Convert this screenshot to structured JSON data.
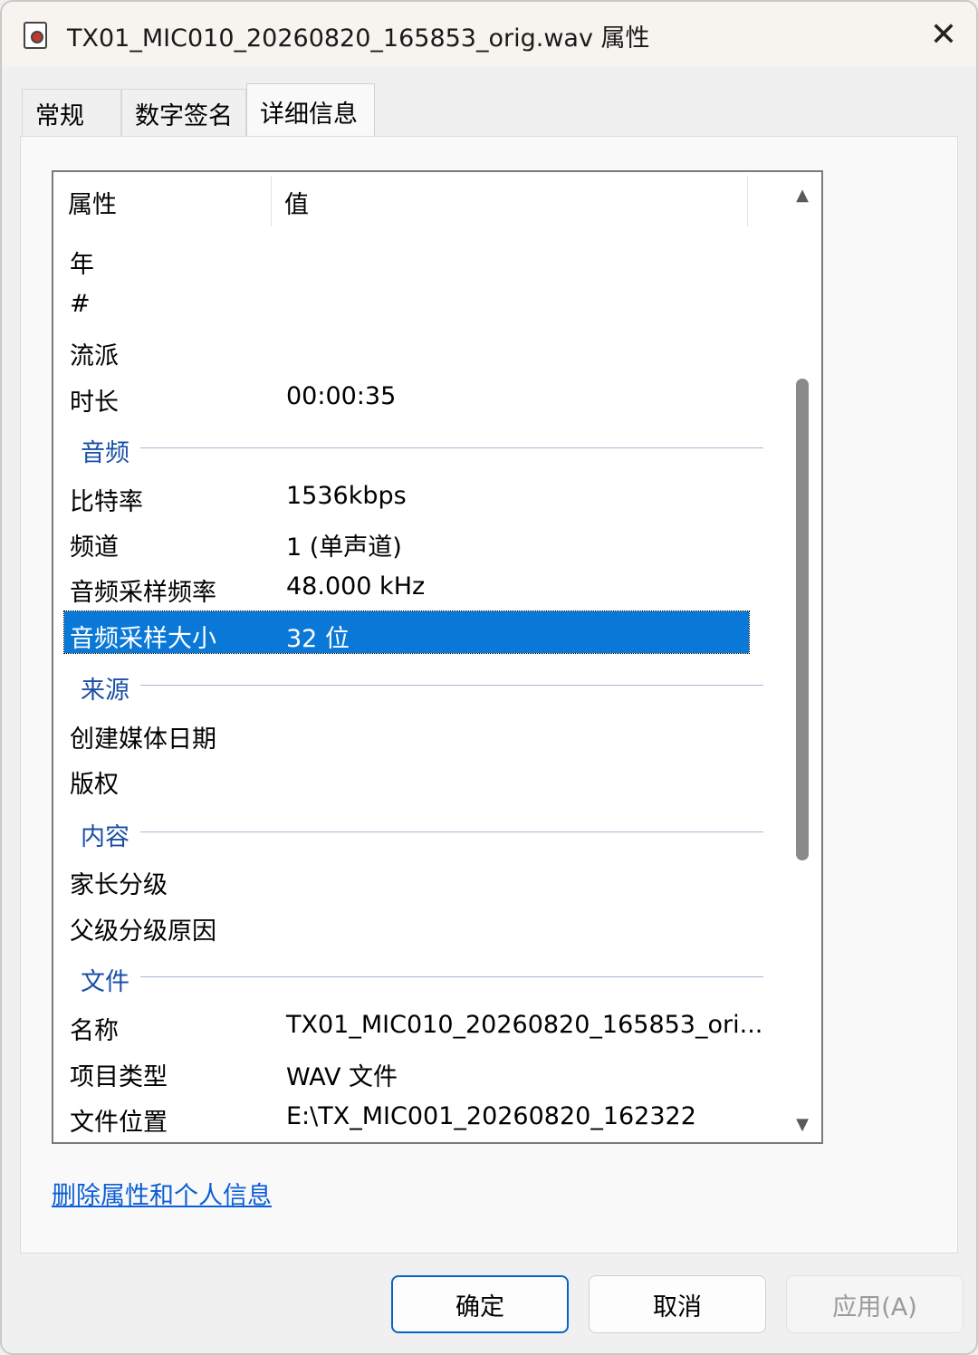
{
  "window": {
    "title": "TX01_MIC010_20260820_165853_orig.wav 属性",
    "close_glyph": "✕"
  },
  "tabs": [
    {
      "label": "常规"
    },
    {
      "label": "数字签名"
    },
    {
      "label": "详细信息"
    }
  ],
  "list": {
    "col_property": "属性",
    "col_value": "值",
    "scroll_up": "▲",
    "scroll_down": "▼",
    "rows_top": [
      {
        "key": "年",
        "value": ""
      },
      {
        "key": "#",
        "value": ""
      },
      {
        "key": "流派",
        "value": ""
      },
      {
        "key": "时长",
        "value": "00:00:35"
      }
    ],
    "groups": {
      "audio": "音频",
      "source": "来源",
      "content": "内容",
      "file": "文件"
    },
    "audio_rows": [
      {
        "key": "比特率",
        "value": "1536kbps"
      },
      {
        "key": "频道",
        "value": "1 (单声道)"
      },
      {
        "key": "音频采样频率",
        "value": "48.000 kHz"
      },
      {
        "key": "音频采样大小",
        "value": "32 位"
      }
    ],
    "source_rows": [
      {
        "key": "创建媒体日期",
        "value": ""
      },
      {
        "key": "版权",
        "value": ""
      }
    ],
    "content_rows": [
      {
        "key": "家长分级",
        "value": ""
      },
      {
        "key": "父级分级原因",
        "value": ""
      }
    ],
    "file_rows": [
      {
        "key": "名称",
        "value": "TX01_MIC010_20260820_165853_ori..."
      },
      {
        "key": "项目类型",
        "value": "WAV 文件"
      },
      {
        "key": "文件位置",
        "value": "E:\\TX_MIC001_20260820_162322"
      }
    ]
  },
  "remove_link": "删除属性和个人信息",
  "buttons": {
    "ok": "确定",
    "cancel": "取消",
    "apply": "应用(A)"
  },
  "colors": {
    "selection": "#0a78d7",
    "group_heading": "#1a4fa8",
    "link": "#0b5ed7"
  }
}
